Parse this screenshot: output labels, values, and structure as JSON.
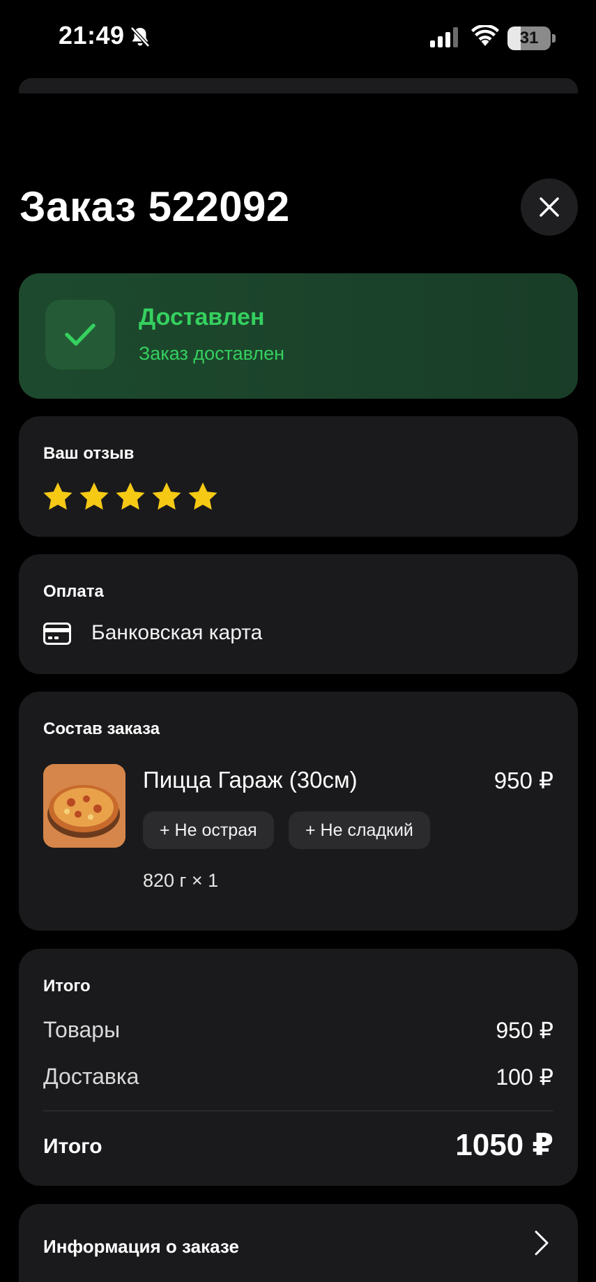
{
  "status_bar": {
    "time": "21:49",
    "battery": "31",
    "battery_level_percent": 31,
    "icons": [
      "bell-slash-icon",
      "signal-icon",
      "wifi-icon",
      "battery-icon"
    ]
  },
  "header": {
    "title": "Заказ 522092",
    "close_icon": "close-icon"
  },
  "order_status": {
    "title": "Доставлен",
    "subtitle": "Заказ доставлен",
    "icon": "check-icon",
    "color": "#35d05f"
  },
  "review": {
    "label": "Ваш отзыв",
    "rating": 5,
    "max_rating": 5,
    "star_color": "#f6c915"
  },
  "payment": {
    "label": "Оплата",
    "method": "Банковская карта",
    "icon": "credit-card-icon"
  },
  "order_items": {
    "label": "Состав заказа",
    "items": [
      {
        "name": "Пицца Гараж (30см)",
        "price": "950 ₽",
        "modifiers": [
          "+ Не острая",
          "+ Не сладкий"
        ],
        "quantity": "820 г × 1"
      }
    ]
  },
  "totals": {
    "label": "Итого",
    "rows": [
      {
        "label": "Товары",
        "value": "950 ₽"
      },
      {
        "label": "Доставка",
        "value": "100 ₽"
      }
    ],
    "total_label": "Итого",
    "total_value": "1050 ₽"
  },
  "info": {
    "label": "Информация о заказе",
    "icon": "chevron-right-icon"
  }
}
